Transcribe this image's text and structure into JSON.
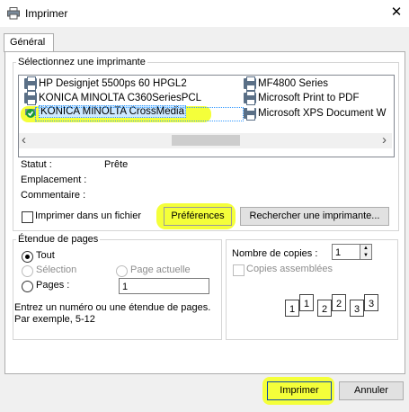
{
  "window": {
    "title": "Imprimer",
    "close_glyph": "✕"
  },
  "tabs": [
    {
      "label": "Général"
    }
  ],
  "printer_group": {
    "label": "Sélectionnez une imprimante",
    "printers": [
      {
        "name": "HP Designjet 5500ps 60 HPGL2"
      },
      {
        "name": "KONICA MINOLTA C360SeriesPCL"
      },
      {
        "name": "KONICA MINOLTA CrossMedia",
        "selected": true
      },
      {
        "name": "MF4800 Series"
      },
      {
        "name": "Microsoft Print to PDF"
      },
      {
        "name": "Microsoft XPS Document W"
      }
    ],
    "scroll_left_glyph": "‹",
    "scroll_right_glyph": "›"
  },
  "status": {
    "statut_label": "Statut :",
    "statut_value": "Prête",
    "emplacement_label": "Emplacement :",
    "commentaire_label": "Commentaire :"
  },
  "print_to_file": {
    "label": "Imprimer dans un fichier",
    "checked": false
  },
  "buttons": {
    "preferences": "Préférences",
    "find_printer": "Rechercher une imprimante...",
    "print": "Imprimer",
    "cancel": "Annuler"
  },
  "page_range": {
    "label": "Étendue de pages",
    "all": "Tout",
    "selection": "Sélection",
    "current_page": "Page actuelle",
    "pages": "Pages :",
    "pages_value": "1",
    "hint_line1": "Entrez un numéro ou une étendue de pages.",
    "hint_line2": "Par exemple, 5-12"
  },
  "copies": {
    "label": "Nombre de copies :",
    "value": "1",
    "collate_label": "Copies assemblées",
    "collate_checked": false,
    "spin_up": "▲",
    "spin_down": "▼",
    "collate_pages": [
      "1",
      "1",
      "2",
      "2",
      "3",
      "3"
    ]
  },
  "colors": {
    "highlight": "#f4ff3a",
    "selection": "#cce8ff"
  }
}
